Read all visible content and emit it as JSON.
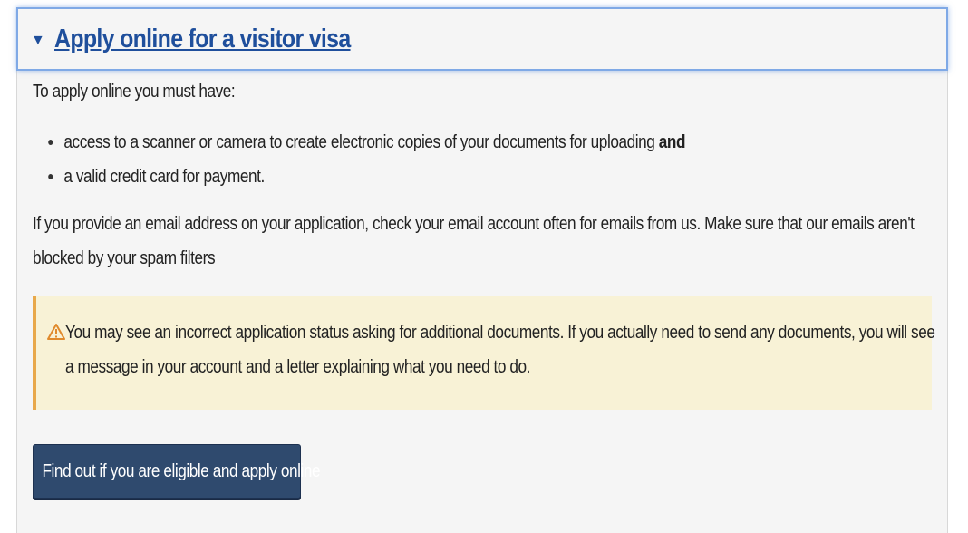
{
  "section": {
    "title": "Apply online for a visitor visa",
    "toggle_glyph": "▼"
  },
  "body": {
    "intro": "To apply online you must have:",
    "requirements": [
      {
        "text": "access to a scanner or camera to create electronic copies of your documents for uploading ",
        "emphasis": "and"
      },
      {
        "text": "a valid credit card for payment.",
        "emphasis": ""
      }
    ],
    "email_note": "If you provide an email address on your application, check your email account often for emails from us. Make sure that our emails aren't blocked by your spam filters"
  },
  "alert": {
    "icon": "warning-icon",
    "text": "You may see an incorrect application status asking for additional documents. If you actually need to send any documents, you will see a message in your account and a letter explaining what you need to do."
  },
  "cta": {
    "label": "Find out if you are eligible and apply online"
  },
  "colors": {
    "link": "#1f4f9c",
    "focus_outline": "#7fa9e6",
    "panel_bg": "#f5f5f5",
    "alert_bg": "#f8f2d6",
    "alert_border": "#e8a84a",
    "button_bg": "#2f4a6e"
  }
}
